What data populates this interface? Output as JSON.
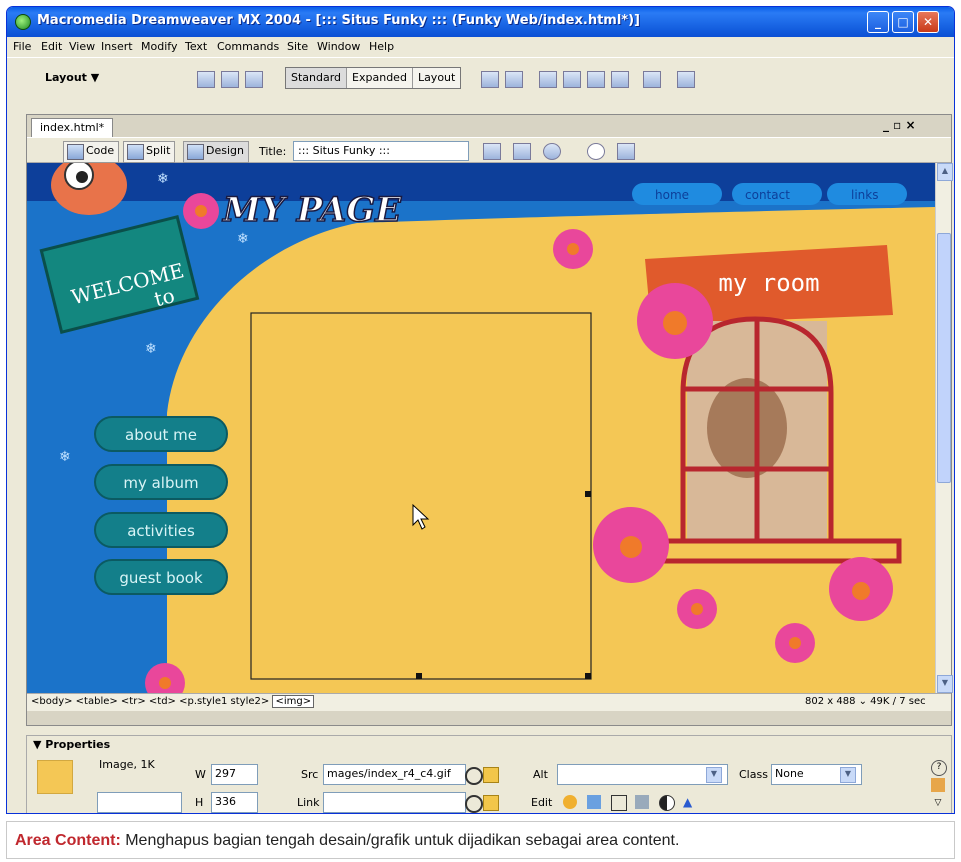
{
  "window": {
    "title": "Macromedia Dreamweaver MX 2004 - [::: Situs Funky ::: (Funky Web/index.html*)]"
  },
  "menubar": [
    "File",
    "Edit",
    "View",
    "Insert",
    "Modify",
    "Text",
    "Commands",
    "Site",
    "Window",
    "Help"
  ],
  "insertbar": {
    "category": "Layout",
    "view_modes": [
      "Standard",
      "Expanded",
      "Layout"
    ],
    "active_mode": "Standard"
  },
  "document": {
    "tab": "index.html*",
    "window_controls": "_ ▫ ×",
    "view_buttons": [
      "Code",
      "Split",
      "Design"
    ],
    "title_label": "Title:",
    "title_value": "::: Situs Funky :::"
  },
  "page": {
    "logo_text": "MY PAGE",
    "welcome_text": "WELCOME",
    "welcome_to": "to",
    "top_nav": [
      "home",
      "contact",
      "links"
    ],
    "side_nav": [
      "about me",
      "my album",
      "activities",
      "guest book"
    ],
    "room_sign": "my room"
  },
  "statusbar": {
    "tags": "<body> <table> <tr> <td> <p.style1 style2>",
    "selected_tag": "<img>",
    "doc_size": "802 x 488 ⌄ 49K / 7 sec"
  },
  "properties": {
    "header": "▼ Properties",
    "type": "Image, 1K",
    "w_label": "W",
    "w_value": "297",
    "h_label": "H",
    "h_value": "336",
    "src_label": "Src",
    "src_value": "mages/index_r4_c4.gif",
    "link_label": "Link",
    "link_value": "",
    "alt_label": "Alt",
    "alt_value": "",
    "edit_label": "Edit",
    "class_label": "Class",
    "class_value": "None"
  },
  "caption": {
    "label": "Area Content:",
    "text": " Menghapus bagian tengah desain/grafik untuk dijadikan sebagai area content."
  },
  "colors": {
    "title_bar": "#1560e0",
    "page_blue": "#1b73c9",
    "page_yellow": "#f4c755",
    "nav_teal": "#137f8a",
    "flower_pink": "#e9479b",
    "sign_red": "#e05a2c",
    "caption_red": "#c0282e"
  }
}
